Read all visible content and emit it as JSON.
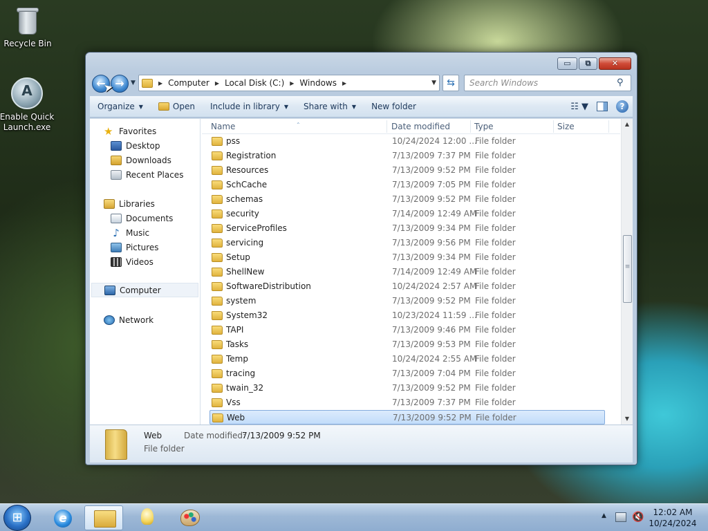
{
  "desktop": {
    "icons": [
      {
        "label": "Recycle Bin",
        "icon": "recycle-bin-icon"
      },
      {
        "label": "Enable Quick Launch.exe",
        "icon": "quick-launch-icon"
      }
    ]
  },
  "window": {
    "controls": {
      "minimize": "▭",
      "maximize": "⧉",
      "close": "✕"
    },
    "breadcrumb": [
      "Computer",
      "Local Disk (C:)",
      "Windows"
    ],
    "search": {
      "placeholder": "Search Windows"
    },
    "toolbar": {
      "organize": "Organize",
      "open": "Open",
      "include_in_library": "Include in library",
      "share_with": "Share with",
      "new_folder": "New folder"
    },
    "nav_pane": {
      "favorites": "Favorites",
      "favorites_items": [
        "Desktop",
        "Downloads",
        "Recent Places"
      ],
      "libraries": "Libraries",
      "libraries_items": [
        "Documents",
        "Music",
        "Pictures",
        "Videos"
      ],
      "computer": "Computer",
      "network": "Network"
    },
    "columns": {
      "name": "Name",
      "date": "Date modified",
      "type": "Type",
      "size": "Size"
    },
    "files": [
      {
        "name": "pss",
        "date": "10/24/2024 12:00 ...",
        "type": "File folder"
      },
      {
        "name": "Registration",
        "date": "7/13/2009 7:37 PM",
        "type": "File folder"
      },
      {
        "name": "Resources",
        "date": "7/13/2009 9:52 PM",
        "type": "File folder"
      },
      {
        "name": "SchCache",
        "date": "7/13/2009 7:05 PM",
        "type": "File folder"
      },
      {
        "name": "schemas",
        "date": "7/13/2009 9:52 PM",
        "type": "File folder"
      },
      {
        "name": "security",
        "date": "7/14/2009 12:49 AM",
        "type": "File folder"
      },
      {
        "name": "ServiceProfiles",
        "date": "7/13/2009 9:34 PM",
        "type": "File folder"
      },
      {
        "name": "servicing",
        "date": "7/13/2009 9:56 PM",
        "type": "File folder"
      },
      {
        "name": "Setup",
        "date": "7/13/2009 9:34 PM",
        "type": "File folder"
      },
      {
        "name": "ShellNew",
        "date": "7/14/2009 12:49 AM",
        "type": "File folder"
      },
      {
        "name": "SoftwareDistribution",
        "date": "10/24/2024 2:57 AM",
        "type": "File folder"
      },
      {
        "name": "system",
        "date": "7/13/2009 9:52 PM",
        "type": "File folder"
      },
      {
        "name": "System32",
        "date": "10/23/2024 11:59 ...",
        "type": "File folder"
      },
      {
        "name": "TAPI",
        "date": "7/13/2009 9:46 PM",
        "type": "File folder"
      },
      {
        "name": "Tasks",
        "date": "7/13/2009 9:53 PM",
        "type": "File folder"
      },
      {
        "name": "Temp",
        "date": "10/24/2024 2:55 AM",
        "type": "File folder"
      },
      {
        "name": "tracing",
        "date": "7/13/2009 7:04 PM",
        "type": "File folder"
      },
      {
        "name": "twain_32",
        "date": "7/13/2009 9:52 PM",
        "type": "File folder"
      },
      {
        "name": "Vss",
        "date": "7/13/2009 7:37 PM",
        "type": "File folder"
      },
      {
        "name": "Web",
        "date": "7/13/2009 9:52 PM",
        "type": "File folder",
        "selected": true
      }
    ],
    "details": {
      "name": "Web",
      "type": "File folder",
      "date_label": "Date modified:",
      "date_value": "7/13/2009 9:52 PM"
    }
  },
  "taskbar": {
    "pinned": [
      "start-orb-icon",
      "internet-explorer-icon",
      "windows-explorer-icon",
      "lightbulb-icon",
      "paint-icon"
    ],
    "clock": {
      "time": "12:02 AM",
      "date": "10/24/2024"
    }
  }
}
